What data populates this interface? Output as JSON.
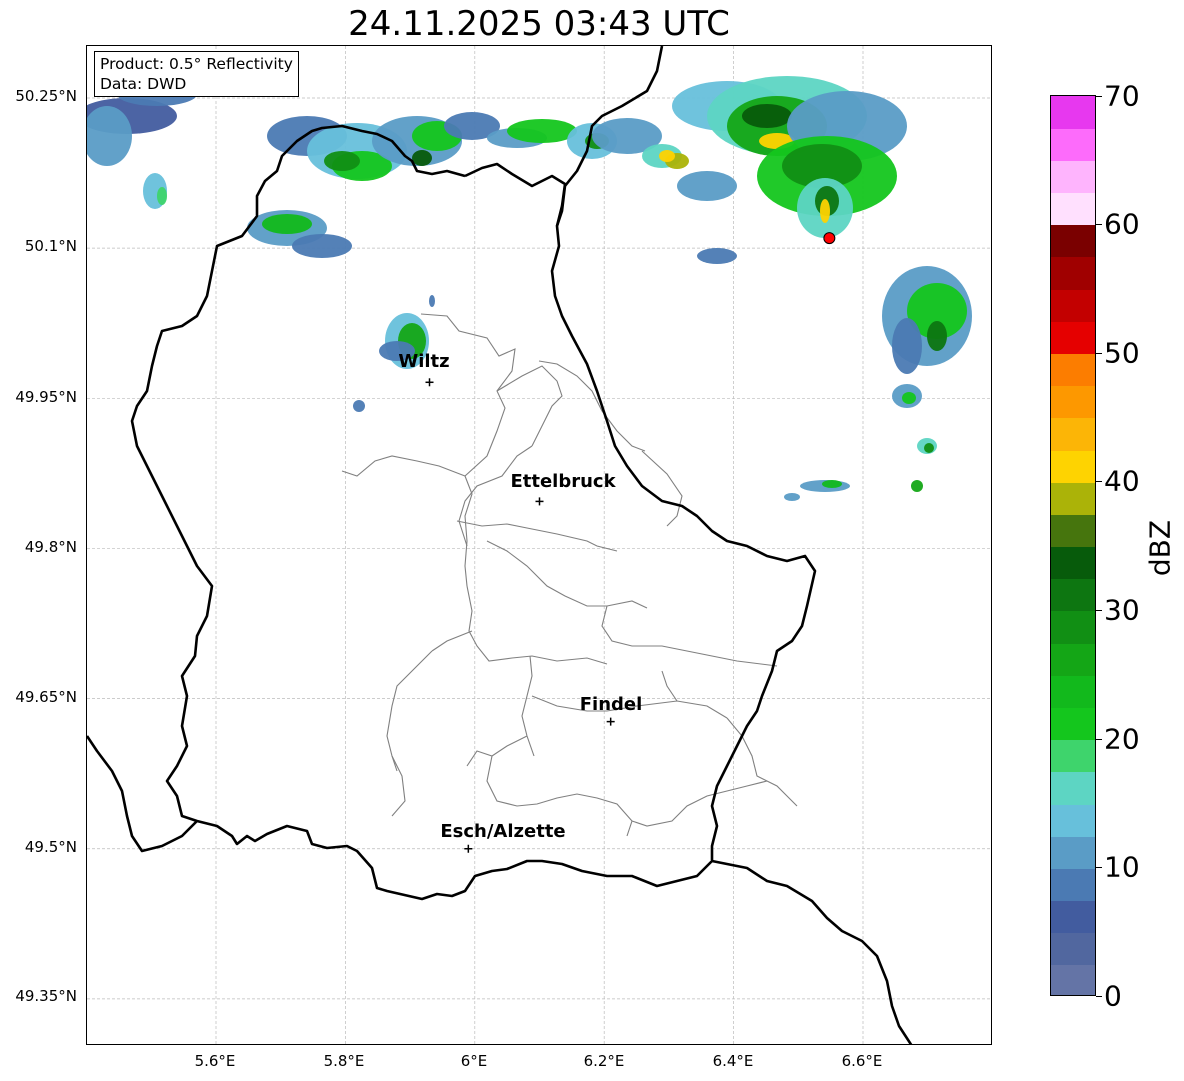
{
  "title": "24.11.2025 03:43 UTC",
  "info": {
    "product": "Product: 0.5° Reflectivity",
    "source": "Data: DWD"
  },
  "axes": {
    "lat_labels": [
      "50.25°N",
      "50.1°N",
      "49.95°N",
      "49.8°N",
      "49.65°N",
      "49.5°N",
      "49.35°N"
    ],
    "lon_labels": [
      "5.6°E",
      "5.8°E",
      "6°E",
      "6.2°E",
      "6.4°E",
      "6.6°E"
    ]
  },
  "cities": [
    {
      "name": "Wiltz",
      "lon": 5.93,
      "lat": 49.966
    },
    {
      "name": "Ettelbruck",
      "lon": 6.1,
      "lat": 49.847
    },
    {
      "name": "Findel",
      "lon": 6.21,
      "lat": 49.627
    },
    {
      "name": "Esch/Alzette",
      "lon": 5.99,
      "lat": 49.5
    }
  ],
  "radar_site": {
    "lon": 6.548,
    "lat": 50.11,
    "color": "#ff0000"
  },
  "colorbar": {
    "label": "dBZ",
    "min": 0,
    "max": 70,
    "tick_labels": [
      "0",
      "10",
      "20",
      "30",
      "40",
      "50",
      "60",
      "70"
    ],
    "colors": [
      "#6474a6",
      "#51679f",
      "#425c9f",
      "#4b7ab3",
      "#5a9cc6",
      "#67c0db",
      "#5dd5c3",
      "#3ed46c",
      "#14c61d",
      "#12b91c",
      "#14a616",
      "#118f14",
      "#0d7611",
      "#075b0b",
      "#46750d",
      "#abb308",
      "#fed301",
      "#fcb506",
      "#fd9800",
      "#fc7d00",
      "#e50000",
      "#c30000",
      "#a00000",
      "#7a0000",
      "#ffe0fe",
      "#feb4fd",
      "#fd6bfb",
      "#e738ef"
    ]
  },
  "map_colors": {
    "border": "#000000",
    "cantons": "#808080",
    "grid": "#bbbbbb"
  }
}
